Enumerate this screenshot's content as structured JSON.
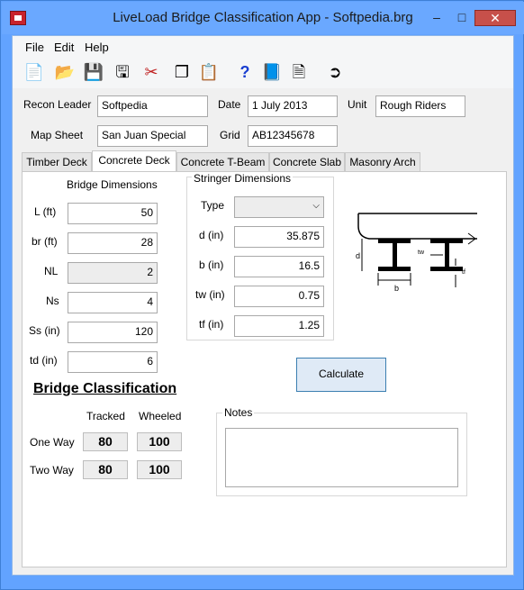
{
  "window": {
    "title": "LiveLoad Bridge Classification App - Softpedia.brg"
  },
  "menu": [
    "File",
    "Edit",
    "Help"
  ],
  "header": {
    "recon_leader_label": "Recon Leader",
    "recon_leader_value": "Softpedia",
    "date_label": "Date",
    "date_value": "1 July 2013",
    "unit_label": "Unit",
    "unit_value": "Rough Riders",
    "map_sheet_label": "Map Sheet",
    "map_sheet_value": "San Juan Special",
    "grid_label": "Grid",
    "grid_value": "AB12345678"
  },
  "tabs": [
    "Timber Deck",
    "Concrete Deck",
    "Concrete T-Beam",
    "Concrete Slab",
    "Masonry Arch"
  ],
  "bridge_dimensions": {
    "title": "Bridge Dimensions",
    "rows": [
      {
        "label": "L (ft)",
        "value": "50"
      },
      {
        "label": "br (ft)",
        "value": "28"
      },
      {
        "label": "NL",
        "value": "2"
      },
      {
        "label": "Ns",
        "value": "4"
      },
      {
        "label": "Ss (in)",
        "value": "120"
      },
      {
        "label": "td (in)",
        "value": "6"
      }
    ]
  },
  "stringer_dimensions": {
    "title": "Stringer Dimensions",
    "type_label": "Type",
    "type_value": "",
    "rows": [
      {
        "label": "d (in)",
        "value": "35.875"
      },
      {
        "label": "b (in)",
        "value": "16.5"
      },
      {
        "label": "tw (in)",
        "value": "0.75"
      },
      {
        "label": "tf (in)",
        "value": "1.25"
      }
    ]
  },
  "diagram": {
    "d": "d",
    "b": "b",
    "tw": "tw",
    "tf": "tf"
  },
  "calculate_label": "Calculate",
  "classification": {
    "title": "Bridge Classification",
    "tracked": "Tracked",
    "wheeled": "Wheeled",
    "one_way": "One Way",
    "two_way": "Two Way",
    "one_tracked": "80",
    "one_wheeled": "100",
    "two_tracked": "80",
    "two_wheeled": "100"
  },
  "notes": {
    "title": "Notes",
    "value": ""
  },
  "colors": {
    "titlebar": "#6aa8ff",
    "close": "#c7504a",
    "button": "#dfeaf6"
  }
}
